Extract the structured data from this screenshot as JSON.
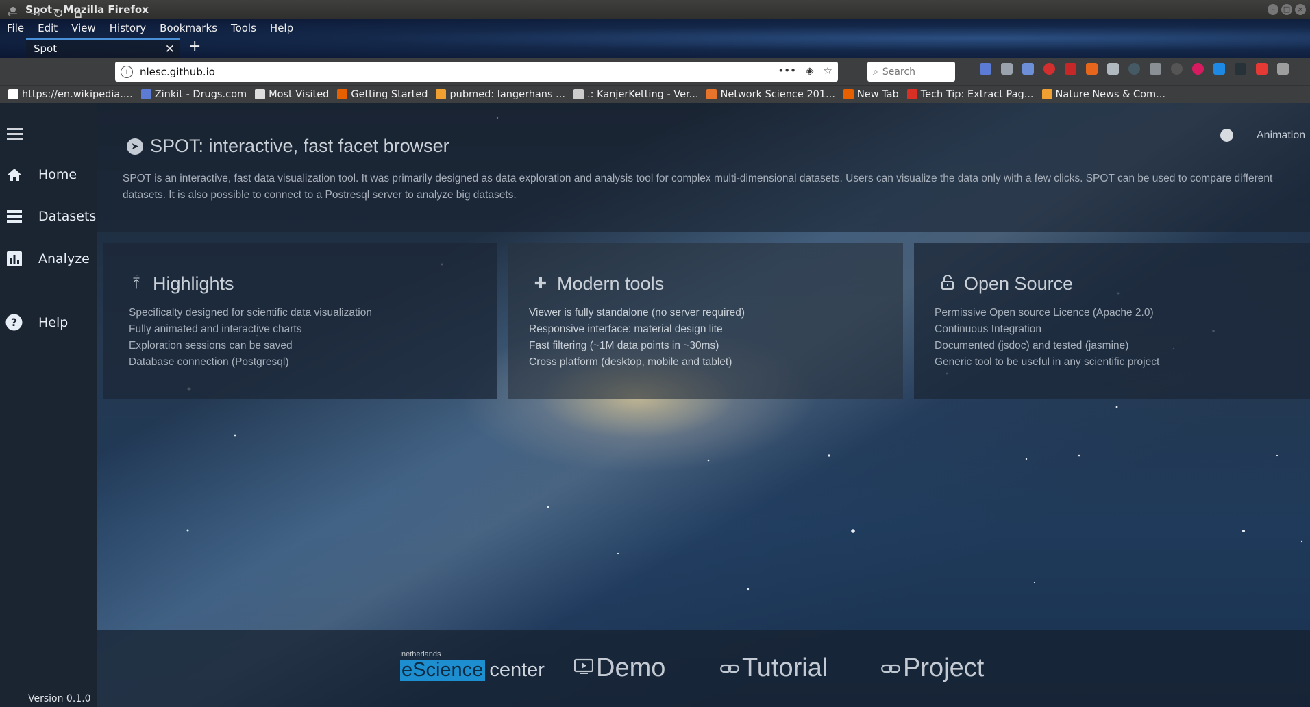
{
  "window": {
    "title": "Spot - Mozilla Firefox"
  },
  "menubar": {
    "items": [
      "File",
      "Edit",
      "View",
      "History",
      "Bookmarks",
      "Tools",
      "Help"
    ]
  },
  "tab": {
    "label": "Spot",
    "close": "✕"
  },
  "newtab": "+",
  "urlbar": {
    "url": "nlesc.github.io"
  },
  "search": {
    "placeholder": "Search"
  },
  "bookmarks": [
    {
      "label": "https://en.wikipedia....",
      "color": "#ffffff"
    },
    {
      "label": "Zinkit - Drugs.com",
      "color": "#5b7bd5"
    },
    {
      "label": "Most Visited",
      "color": "#dddddd"
    },
    {
      "label": "Getting Started",
      "color": "#e66000"
    },
    {
      "label": "pubmed: langerhans ...",
      "color": "#f0a030"
    },
    {
      "label": ".: KanjerKetting - Ver...",
      "color": "#cccccc"
    },
    {
      "label": "Network Science 201...",
      "color": "#e8742b"
    },
    {
      "label": "New Tab",
      "color": "#e66000"
    },
    {
      "label": "Tech Tip: Extract Pag...",
      "color": "#d93025"
    },
    {
      "label": "Nature News & Com...",
      "color": "#f0a030"
    }
  ],
  "sidebar": {
    "items": [
      {
        "label": "Home",
        "icon": "home-icon"
      },
      {
        "label": "Datasets",
        "icon": "list-icon"
      },
      {
        "label": "Analyze",
        "icon": "bar-chart-icon"
      },
      {
        "label": "Help",
        "icon": "help-icon"
      }
    ],
    "version": "Version 0.1.0"
  },
  "hero": {
    "title": "SPOT: interactive, fast facet browser",
    "description": "SPOT is an interactive, fast data visualization tool. It was primarily designed as data exploration and analysis tool for complex multi-dimensional datasets. Users can visualize the data only with a few clicks. SPOT can be used to compare different datasets. It is also possible to connect to a Postresql server to analyze big datasets.",
    "animation_label": "Animation"
  },
  "cards": [
    {
      "title": "Highlights",
      "icon": "merge-icon",
      "items": [
        "Specificalty designed for scientific data visualization",
        "Fully animated and interactive charts",
        "Exploration sessions can be saved",
        "Database connection (Postgresql)"
      ]
    },
    {
      "title": "Modern tools",
      "icon": "puzzle-icon",
      "items": [
        "Viewer is fully standalone (no server required)",
        "Responsive interface: material design lite",
        "Fast filtering (~1M data points in ~30ms)",
        "Cross platform (desktop, mobile and tablet)"
      ]
    },
    {
      "title": "Open Source",
      "icon": "lock-open-icon",
      "items": [
        "Permissive Open source Licence (Apache 2.0)",
        "Continuous Integration",
        "Documented (jsdoc) and tested (jasmine)",
        "Generic tool to be useful in any scientific project"
      ]
    }
  ],
  "footer": {
    "logo_small": "netherlands",
    "logo_highlight": "eScience",
    "logo_rest": "center",
    "links": [
      {
        "label": "Demo",
        "icon": "video-icon"
      },
      {
        "label": "Tutorial",
        "icon": "link-icon"
      },
      {
        "label": "Project",
        "icon": "link-icon"
      }
    ]
  },
  "colors": {
    "accent": "#1d8ecf",
    "sidebar": "#1b2431"
  }
}
